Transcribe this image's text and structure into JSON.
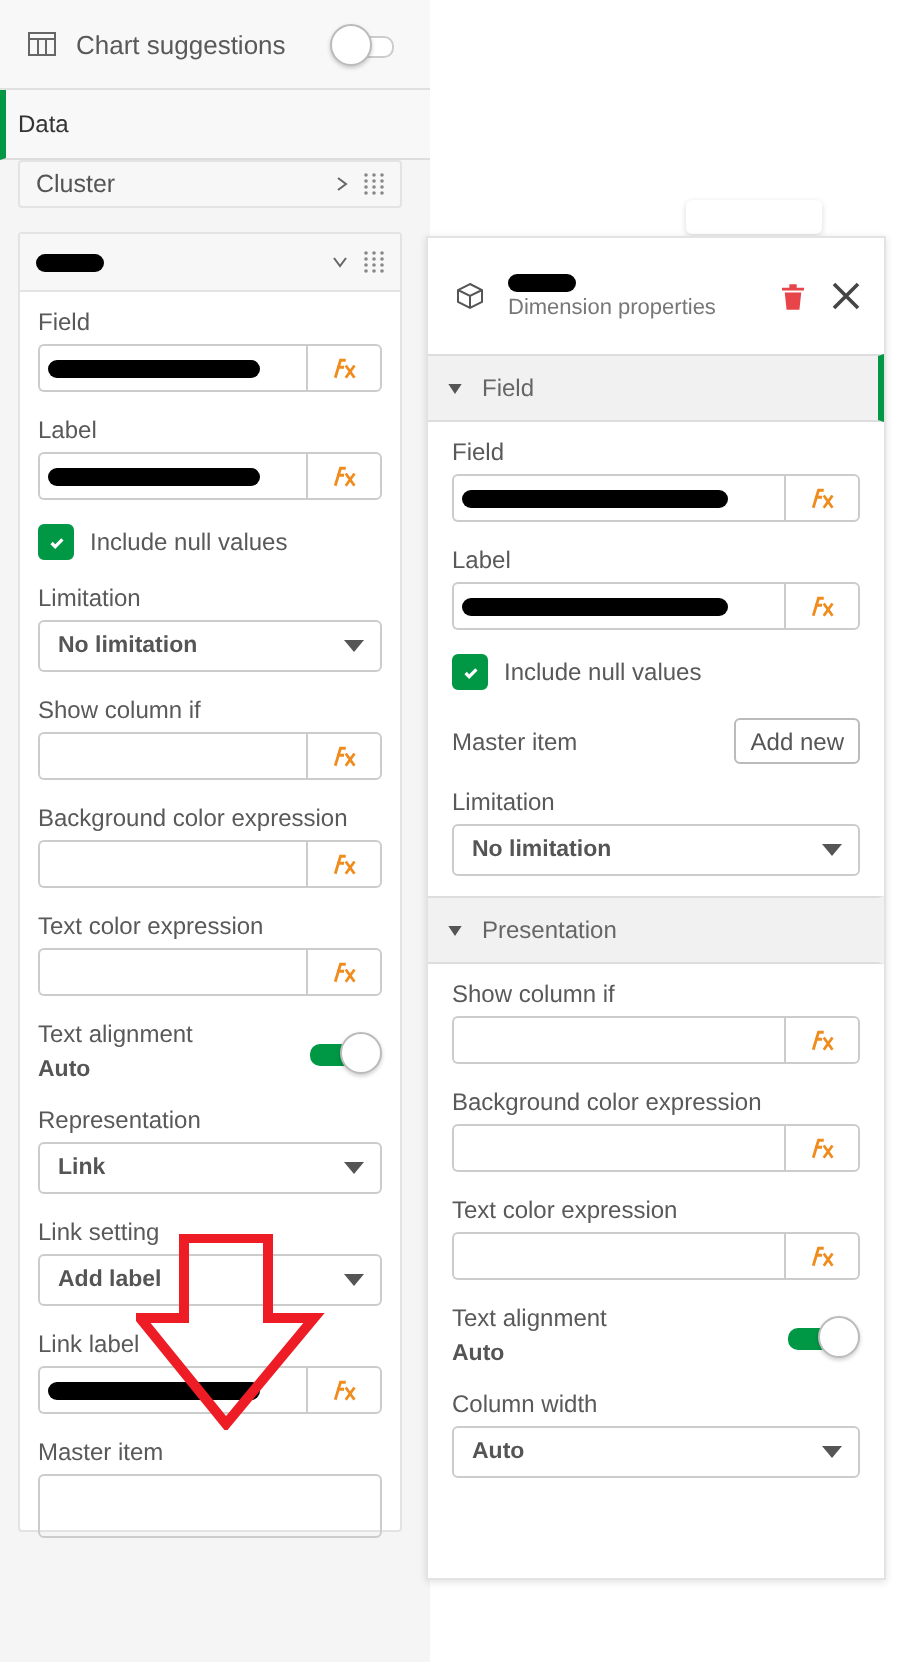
{
  "header": {
    "title": "Chart suggestions",
    "on": false
  },
  "tab": {
    "label": "Data",
    "selected": true
  },
  "cluster": {
    "title": "Cluster",
    "expanded": false
  },
  "left_form": {
    "expanded": true,
    "title_redacted": true,
    "rows": [
      {
        "kind": "expression",
        "label": "Field",
        "redacted": true
      },
      {
        "kind": "expression",
        "label": "Label",
        "redacted": true
      },
      {
        "kind": "checkbox",
        "label": "Include null values",
        "checked": true
      },
      {
        "kind": "select",
        "label": "Limitation",
        "value": "No limitation"
      },
      {
        "kind": "expression",
        "label": "Show column if",
        "redacted": false
      },
      {
        "kind": "expression",
        "label": "Background color expression",
        "redacted": false
      },
      {
        "kind": "expression",
        "label": "Text color expression",
        "redacted": false
      },
      {
        "kind": "toggle",
        "label": "Text alignment",
        "value": "Auto",
        "on": true
      },
      {
        "kind": "select",
        "label": "Representation",
        "value": "Link"
      },
      {
        "kind": "select",
        "label": "Link setting",
        "value": "Add label"
      },
      {
        "kind": "expression",
        "label": "Link label",
        "redacted": true
      },
      {
        "kind": "master_cut",
        "label": "Master item"
      }
    ]
  },
  "panel": {
    "title_redacted": true,
    "subtitle": "Dimension properties",
    "sections": [
      {
        "title": "Field",
        "expanded": true,
        "selected": true,
        "rows": [
          {
            "kind": "expression",
            "label": "Field",
            "redacted": true
          },
          {
            "kind": "expression",
            "label": "Label",
            "redacted": true
          },
          {
            "kind": "checkbox",
            "label": "Include null values",
            "checked": true
          },
          {
            "kind": "master",
            "label": "Master item",
            "button": "Add new"
          },
          {
            "kind": "select",
            "label": "Limitation",
            "value": "No limitation"
          }
        ]
      },
      {
        "title": "Presentation",
        "expanded": true,
        "selected": false,
        "rows": [
          {
            "kind": "expression",
            "label": "Show column if",
            "redacted": false
          },
          {
            "kind": "expression",
            "label": "Background color expression",
            "redacted": false
          },
          {
            "kind": "expression",
            "label": "Text color expression",
            "redacted": false
          },
          {
            "kind": "toggle",
            "label": "Text alignment",
            "value": "Auto",
            "on": true
          },
          {
            "kind": "select",
            "label": "Column width",
            "value": "Auto"
          }
        ]
      }
    ]
  }
}
